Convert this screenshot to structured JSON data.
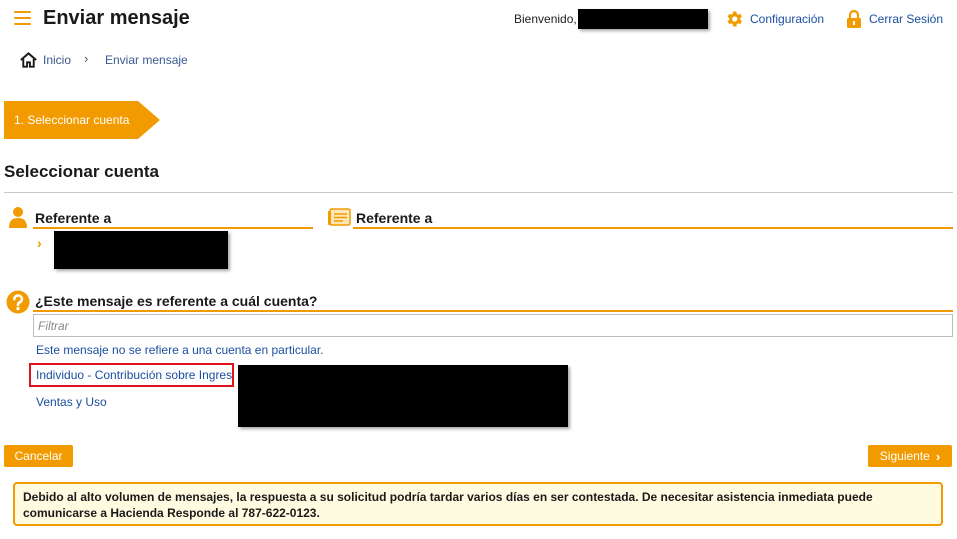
{
  "header": {
    "title": "Enviar mensaje",
    "welcome": "Bienvenido,",
    "settings": "Configuración",
    "logout": "Cerrar Sesión"
  },
  "breadcrumb": {
    "home": "Inicio",
    "separator": "›",
    "current": "Enviar mensaje"
  },
  "steps": [
    {
      "label": "1. Seleccionar cuenta"
    }
  ],
  "section": {
    "title": "Seleccionar cuenta",
    "referente_left": "Referente a",
    "referente_right": "Referente a"
  },
  "question": {
    "label": "¿Este mensaje es referente a cuál cuenta?",
    "filter_placeholder": "Filtrar",
    "options": [
      "Este mensaje no se refiere a una cuenta en particular.",
      "Individuo - Contribución sobre Ingresos",
      "Ventas y Uso"
    ]
  },
  "buttons": {
    "cancel": "Cancelar",
    "next": "Siguiente"
  },
  "notice": "Debido al alto volumen de mensajes, la respuesta a su solicitud podría tardar varios días en ser contestada. De necesitar asistencia inmediata puede comunicarse a Hacienda Responde al 787-622-0123.",
  "colors": {
    "accent": "#f29b00",
    "link": "#1a4fa0",
    "highlight_border": "#e0121a",
    "notice_bg": "#fffbe0"
  },
  "icons": [
    "menu-icon",
    "gear-icon",
    "lock-icon",
    "home-icon",
    "person-icon",
    "document-icon",
    "question-icon",
    "chevron-right-icon"
  ]
}
